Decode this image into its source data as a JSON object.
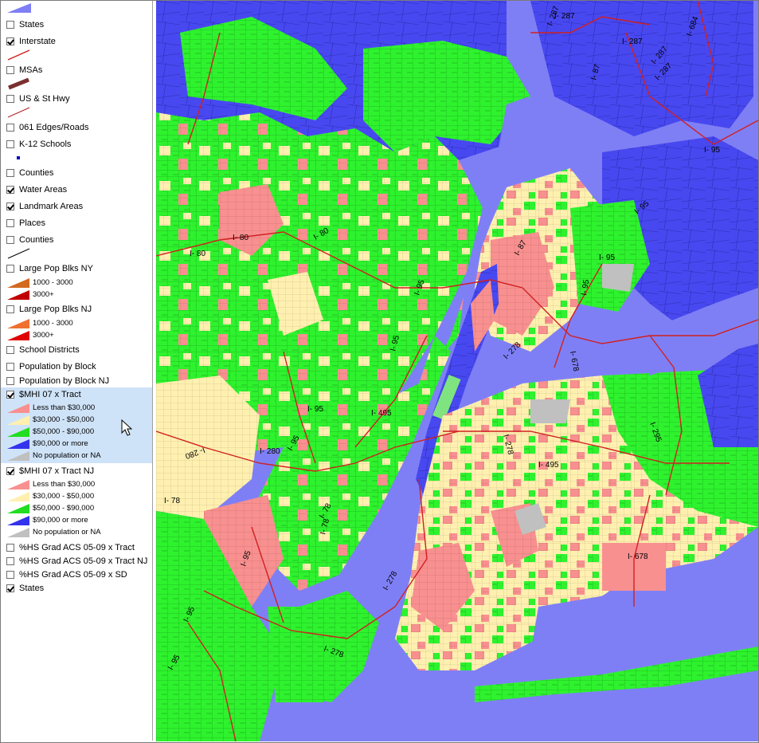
{
  "legend": {
    "layers": [
      {
        "label": "States",
        "checked": false
      },
      {
        "label": "Interstate",
        "checked": true
      },
      {
        "label": "MSAs",
        "checked": false
      },
      {
        "label": "US & St Hwy",
        "checked": false
      },
      {
        "label": "061 Edges/Roads",
        "checked": false
      },
      {
        "label": "K-12 Schools",
        "checked": false
      },
      {
        "label": "Counties",
        "checked": false
      },
      {
        "label": "Water Areas",
        "checked": true
      },
      {
        "label": "Landmark Areas",
        "checked": true
      },
      {
        "label": "Places",
        "checked": false
      },
      {
        "label": "Counties",
        "checked": false
      },
      {
        "label": "Large Pop Blks NY",
        "checked": false
      },
      {
        "label": "Large Pop Blks NJ",
        "checked": false
      },
      {
        "label": "School Districts",
        "checked": false
      },
      {
        "label": "Population by Block",
        "checked": false
      },
      {
        "label": "Population by Block NJ",
        "checked": false
      },
      {
        "label": "$MHI 07 x Tract",
        "checked": true
      },
      {
        "label": "$MHI 07 x Tract NJ",
        "checked": true
      },
      {
        "label": "%HS Grad ACS 05-09 x Tract",
        "checked": false
      },
      {
        "label": "%HS Grad ACS 05-09 x Tract NJ",
        "checked": false
      },
      {
        "label": "%HS Grad ACS 05-09 x SD",
        "checked": false
      },
      {
        "label": "States",
        "checked": true
      }
    ],
    "popblk_ny": [
      {
        "label": "1000 - 3000",
        "color": "#d2691e"
      },
      {
        "label": "3000+",
        "color": "#c00000"
      }
    ],
    "popblk_nj": [
      {
        "label": "1000 - 3000",
        "color": "#f07030"
      },
      {
        "label": "3000+",
        "color": "#e00000"
      }
    ],
    "mhi_classes": [
      {
        "label": "Less than $30,000",
        "color": "#f89090"
      },
      {
        "label": "$30,000 - $50,000",
        "color": "#fff0b0"
      },
      {
        "label": "$50,000 - $90,000",
        "color": "#22dd22"
      },
      {
        "label": "$90,000 or more",
        "color": "#3333ee"
      },
      {
        "label": "No population or NA",
        "color": "#c0c0c0"
      }
    ],
    "mhi_nj_classes": [
      {
        "label": "Less than $30,000",
        "color": "#f89090"
      },
      {
        "label": "$30,000 - $50,000",
        "color": "#fff0b0"
      },
      {
        "label": "$50,000 - $90,000",
        "color": "#22dd22"
      },
      {
        "label": "$90,000 or more",
        "color": "#3333ee"
      },
      {
        "label": "No population or NA",
        "color": "#c0c0c0"
      }
    ]
  },
  "map": {
    "colors": {
      "water": "#7f7ff5",
      "low": "#f89090",
      "midlow": "#fff0b0",
      "mid": "#2ef22e",
      "high": "#4848f0",
      "na": "#c0c0c0",
      "interstate": "#d02020"
    },
    "route_labels": [
      "I- 287",
      "I- 287",
      "I- 87",
      "I- 287",
      "I- 684",
      "I- 287",
      "I- 95",
      "I- 95",
      "I- 80",
      "I- 80",
      "I- 80",
      "I- 95",
      "I- 87",
      "I- 95",
      "I- 95",
      "I- 95",
      "I- 278",
      "I- 278",
      "I- 495",
      "I- 495",
      "I- 280",
      "I- 280",
      "I- 95",
      "I- 95",
      "I- 78",
      "I- 78",
      "I- 78",
      "I- 95",
      "I- 295",
      "I- 678",
      "I- 678",
      "I- 278",
      "I- 278",
      "I- 95",
      "I- 95",
      "I- 287"
    ]
  }
}
